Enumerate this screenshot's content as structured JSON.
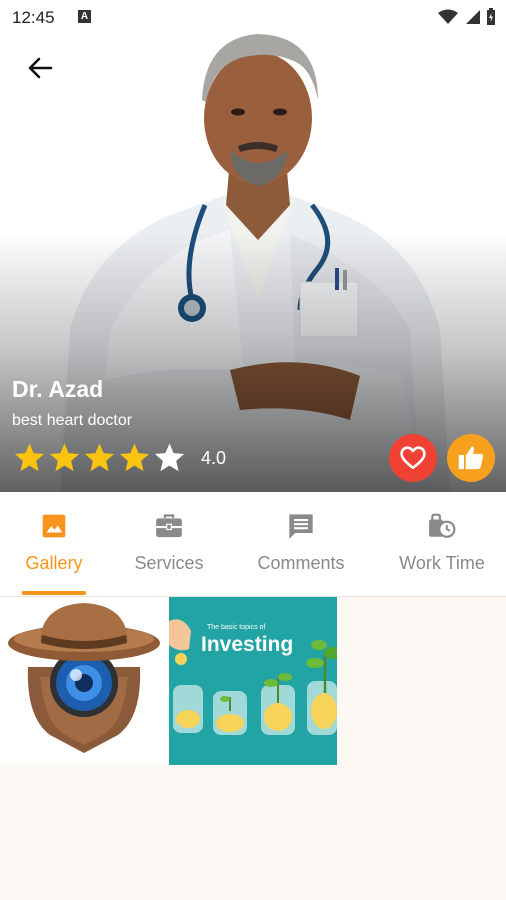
{
  "status_bar": {
    "time": "12:45",
    "notification_badge": "A"
  },
  "doctor": {
    "name": "Dr. Azad",
    "specialty": "best heart doctor",
    "rating_value": "4.0",
    "rating_stars_filled": 4,
    "rating_stars_total": 5
  },
  "actions": {
    "favorite_icon": "heart-icon",
    "like_icon": "thumbs-up-icon"
  },
  "tabs": [
    {
      "label": "Gallery",
      "icon": "image-icon",
      "active": true
    },
    {
      "label": "Services",
      "icon": "briefcase-icon",
      "active": false
    },
    {
      "label": "Comments",
      "icon": "comment-icon",
      "active": false
    },
    {
      "label": "Work Time",
      "icon": "clock-bag-icon",
      "active": false
    }
  ],
  "gallery": {
    "items": [
      {
        "label": ""
      },
      {
        "label": "Investing",
        "caption_small": "The basic topics of"
      }
    ]
  },
  "colors": {
    "accent": "#f7941d",
    "favorite": "#ef4235",
    "like": "#f7a01d",
    "background": "#fdf8f3"
  }
}
